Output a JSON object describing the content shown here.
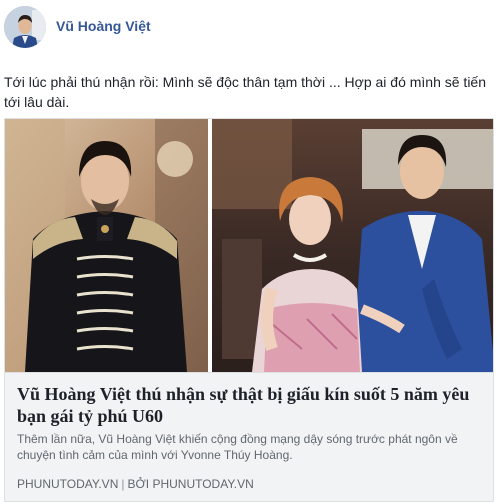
{
  "post": {
    "author": "Vũ Hoàng Việt",
    "text": "Tới lúc phải thú nhận rồi: Mình sẽ độc thân tạm thời ... Hợp ai đó mình sẽ tiến tới lâu dài."
  },
  "link_preview": {
    "title": "Vũ Hoàng Việt thú nhận sự thật bị giấu kín suốt 5 năm yêu bạn gái tỷ phú U60",
    "description": "Thêm lần nữa, Vũ Hoàng Việt khiến cộng đồng mạng dậy sóng trước phát ngôn về chuyện tình cảm của mình với Yvonne Thúy Hoàng.",
    "domain": "PHUNUTODAY.VN",
    "separator": "|",
    "byline": "BỞI PHUNUTODAY.VN"
  },
  "colors": {
    "author_link": "#365899",
    "preview_bg": "#f2f3f5",
    "muted_text": "#606770"
  }
}
